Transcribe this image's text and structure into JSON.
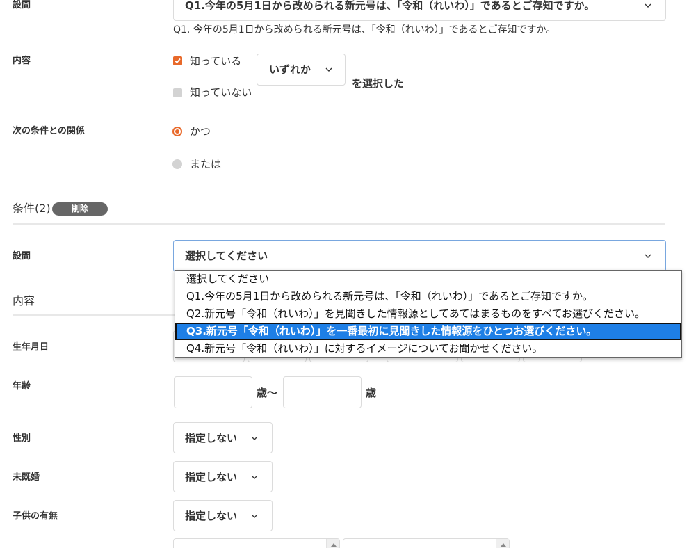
{
  "colors": {
    "accent": "#e8692a",
    "highlight": "#1e7fe6",
    "focus": "#79a7df"
  },
  "condition1": {
    "question": {
      "label": "設問",
      "selected": "Q1.今年の5月1日から改められる新元号は、「令和（れいわ）」であるとご存知ですか。",
      "description": "Q1. 今年の5月1日から改められる新元号は、「令和（れいわ）」であるとご存知ですか。"
    },
    "content": {
      "label": "内容",
      "options": [
        {
          "label": "知っている",
          "checked": true
        },
        {
          "label": "知っていない",
          "checked": false
        }
      ],
      "mode_select": "いずれか",
      "suffix": "を選択した"
    },
    "relation": {
      "label": "次の条件との関係",
      "options": [
        {
          "label": "かつ",
          "selected": true
        },
        {
          "label": "または",
          "selected": false
        }
      ]
    }
  },
  "condition2": {
    "title": "条件(2)",
    "delete_label": "削除",
    "question": {
      "label": "設問",
      "selected": "選択してください",
      "dropdown_options": [
        "選択してください",
        "Q1.今年の5月1日から改められる新元号は、「令和（れいわ）」であるとご存知ですか。",
        "Q2.新元号「令和（れいわ）」を見聞きした情報源としてあてはまるものをすべてお選びください。",
        "Q3.新元号「令和（れいわ）」を一番最初に見聞きした情報源をひとつお選びください。",
        "Q4.新元号「令和（れいわ）」に対するイメージについてお聞かせください。"
      ],
      "highlighted_index": 3
    },
    "content_heading": "内容",
    "birthdate": {
      "label": "生年月日"
    },
    "age": {
      "label": "年齢",
      "from_unit": "歳〜",
      "to_unit": "歳"
    },
    "gender": {
      "label": "性別",
      "value": "指定しない"
    },
    "marital": {
      "label": "未既婚",
      "value": "指定しない"
    },
    "children": {
      "label": "子供の有無",
      "value": "指定しない"
    }
  }
}
